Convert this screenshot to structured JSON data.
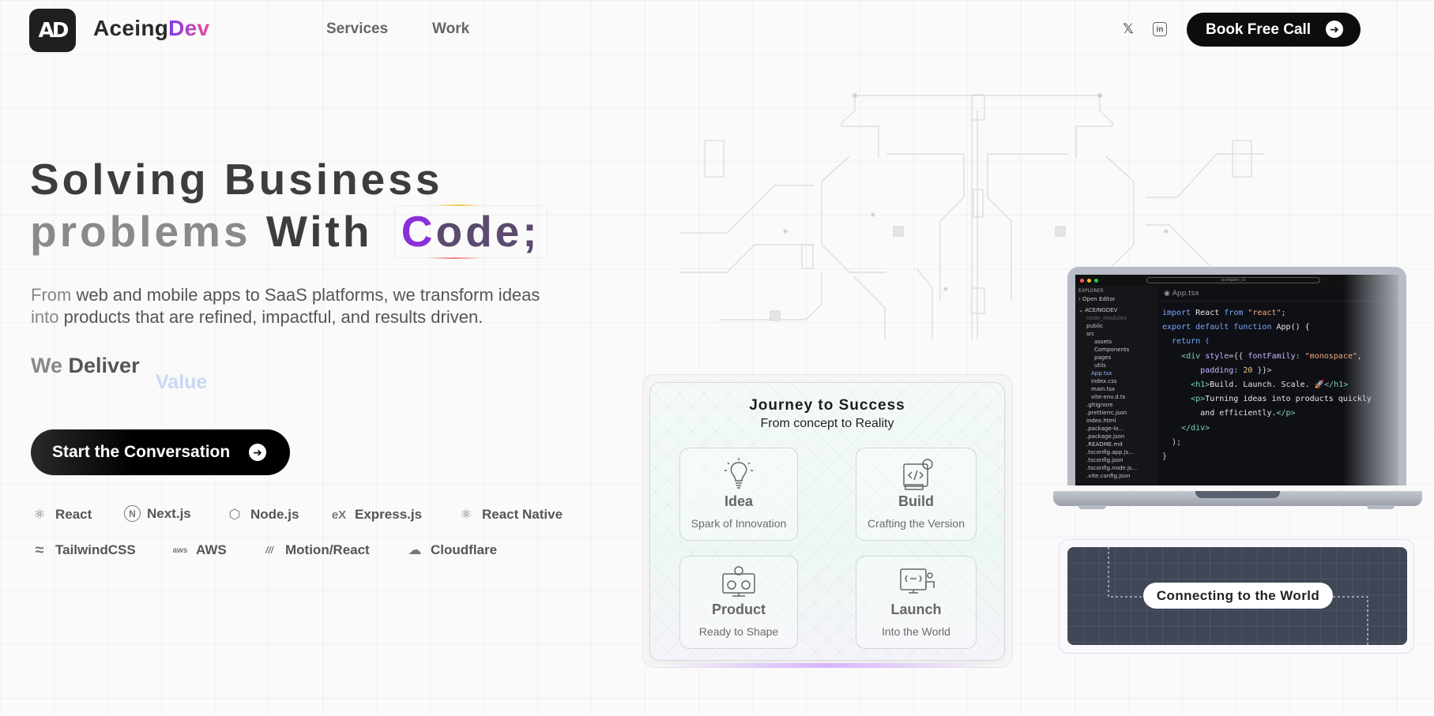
{
  "header": {
    "logo_text": "AD",
    "brand_main": "Aceing",
    "brand_accent": "Dev",
    "nav": {
      "services": "Services",
      "work": "Work"
    },
    "social": {
      "x": "𝕏",
      "linkedin": "in"
    },
    "cta": "Book Free Call"
  },
  "hero": {
    "title_line1": "Solving Business",
    "title_line2_dim": "problems",
    "title_line2_rest": " With",
    "code_c": "C",
    "code_rest": "ode;",
    "sub_lead": "From",
    "sub_rest_line1": " web and mobile apps to SaaS platforms, we transform ideas",
    "sub_line2_lead": "into",
    "sub_line2_rest": " products that are refined, impactful, and results driven.",
    "deliver_we": "We",
    "deliver_rest": " Deliver",
    "deliver_value": "Value",
    "cta": "Start the Conversation"
  },
  "tech_stack": [
    {
      "name": "React",
      "icon": "react-icon",
      "glyph": "⚛"
    },
    {
      "name": "Next.js",
      "icon": "nextjs-icon",
      "glyph": "N"
    },
    {
      "name": "Node.js",
      "icon": "nodejs-icon",
      "glyph": "⬡"
    },
    {
      "name": "Express.js",
      "icon": "express-icon",
      "glyph": "eX"
    },
    {
      "name": "React Native",
      "icon": "react-native-icon",
      "glyph": "⚛"
    },
    {
      "name": "TailwindCSS",
      "icon": "tailwind-icon",
      "glyph": "≈"
    },
    {
      "name": "AWS",
      "icon": "aws-icon",
      "glyph": "aws"
    },
    {
      "name": "Motion/React",
      "icon": "motion-icon",
      "glyph": "///"
    },
    {
      "name": "Cloudflare",
      "icon": "cloudflare-icon",
      "glyph": "☁"
    }
  ],
  "journey": {
    "title": "Journey to Success",
    "subtitle": "From concept to Reality",
    "steps": [
      {
        "name": "Idea",
        "desc": "Spark of Innovation",
        "icon": "lightbulb-icon"
      },
      {
        "name": "Build",
        "desc": "Crafting the Version",
        "icon": "code-build-icon"
      },
      {
        "name": "Product",
        "desc": "Ready to Shape",
        "icon": "monitor-gear-icon"
      },
      {
        "name": "Launch",
        "desc": "Into the World",
        "icon": "presentation-icon"
      }
    ]
  },
  "laptop": {
    "search_text": "aceingdev_v3",
    "explorer_title": "EXPLORER",
    "open_editor": "Open Editor",
    "project": "ACEINGDEV",
    "files": [
      "node_modules",
      "public",
      "src",
      "assets",
      "Components",
      "pages",
      "utils",
      "App.tsx",
      "index.css",
      "main.tsx",
      "vite-env.d.ts",
      ".gitignore",
      ".prettierrc.json",
      "index.html",
      ".package-lo...",
      ".package.json",
      ".README.md",
      ".tsconfig.app.js...",
      ".tsconfig.json",
      ".tsconfig.node.js...",
      ".vite.config.json"
    ],
    "tab": "App.tsx",
    "code": {
      "l1_kw": "import",
      "l1_mid": " React ",
      "l1_kw2": "from",
      "l1_str": " \"react\"",
      "l1_end": ";",
      "l2_kw": "export default function",
      "l2_rest": " App() {",
      "l3": "  return (",
      "l4_tag": "    <div",
      "l4_prop": " style",
      "l4_mid": "={{ ",
      "l4_prop2": "fontFamily",
      "l4_colon": ": ",
      "l4_str": "\"monospace\"",
      "l4_end": ",",
      "l5_prop": "        padding",
      "l5_colon": ": ",
      "l5_num": "20",
      "l5_end": " }}>",
      "l6_tag": "      <h1>",
      "l6_txt": "Build. Launch. Scale. 🚀",
      "l6_end": "</h1>",
      "l7_tag": "      <p>",
      "l7_txt": "Turning ideas into products quickly",
      "l8_txt": "        and efficiently.",
      "l8_end": "</p>",
      "l9": "    </div>",
      "l10": "  );",
      "l11": "}"
    }
  },
  "world": {
    "label": "Connecting to the World"
  },
  "colors": {
    "accent_purple": "#7c3aed",
    "accent_pink": "#ec4899",
    "dark": "#0d0d0d"
  }
}
